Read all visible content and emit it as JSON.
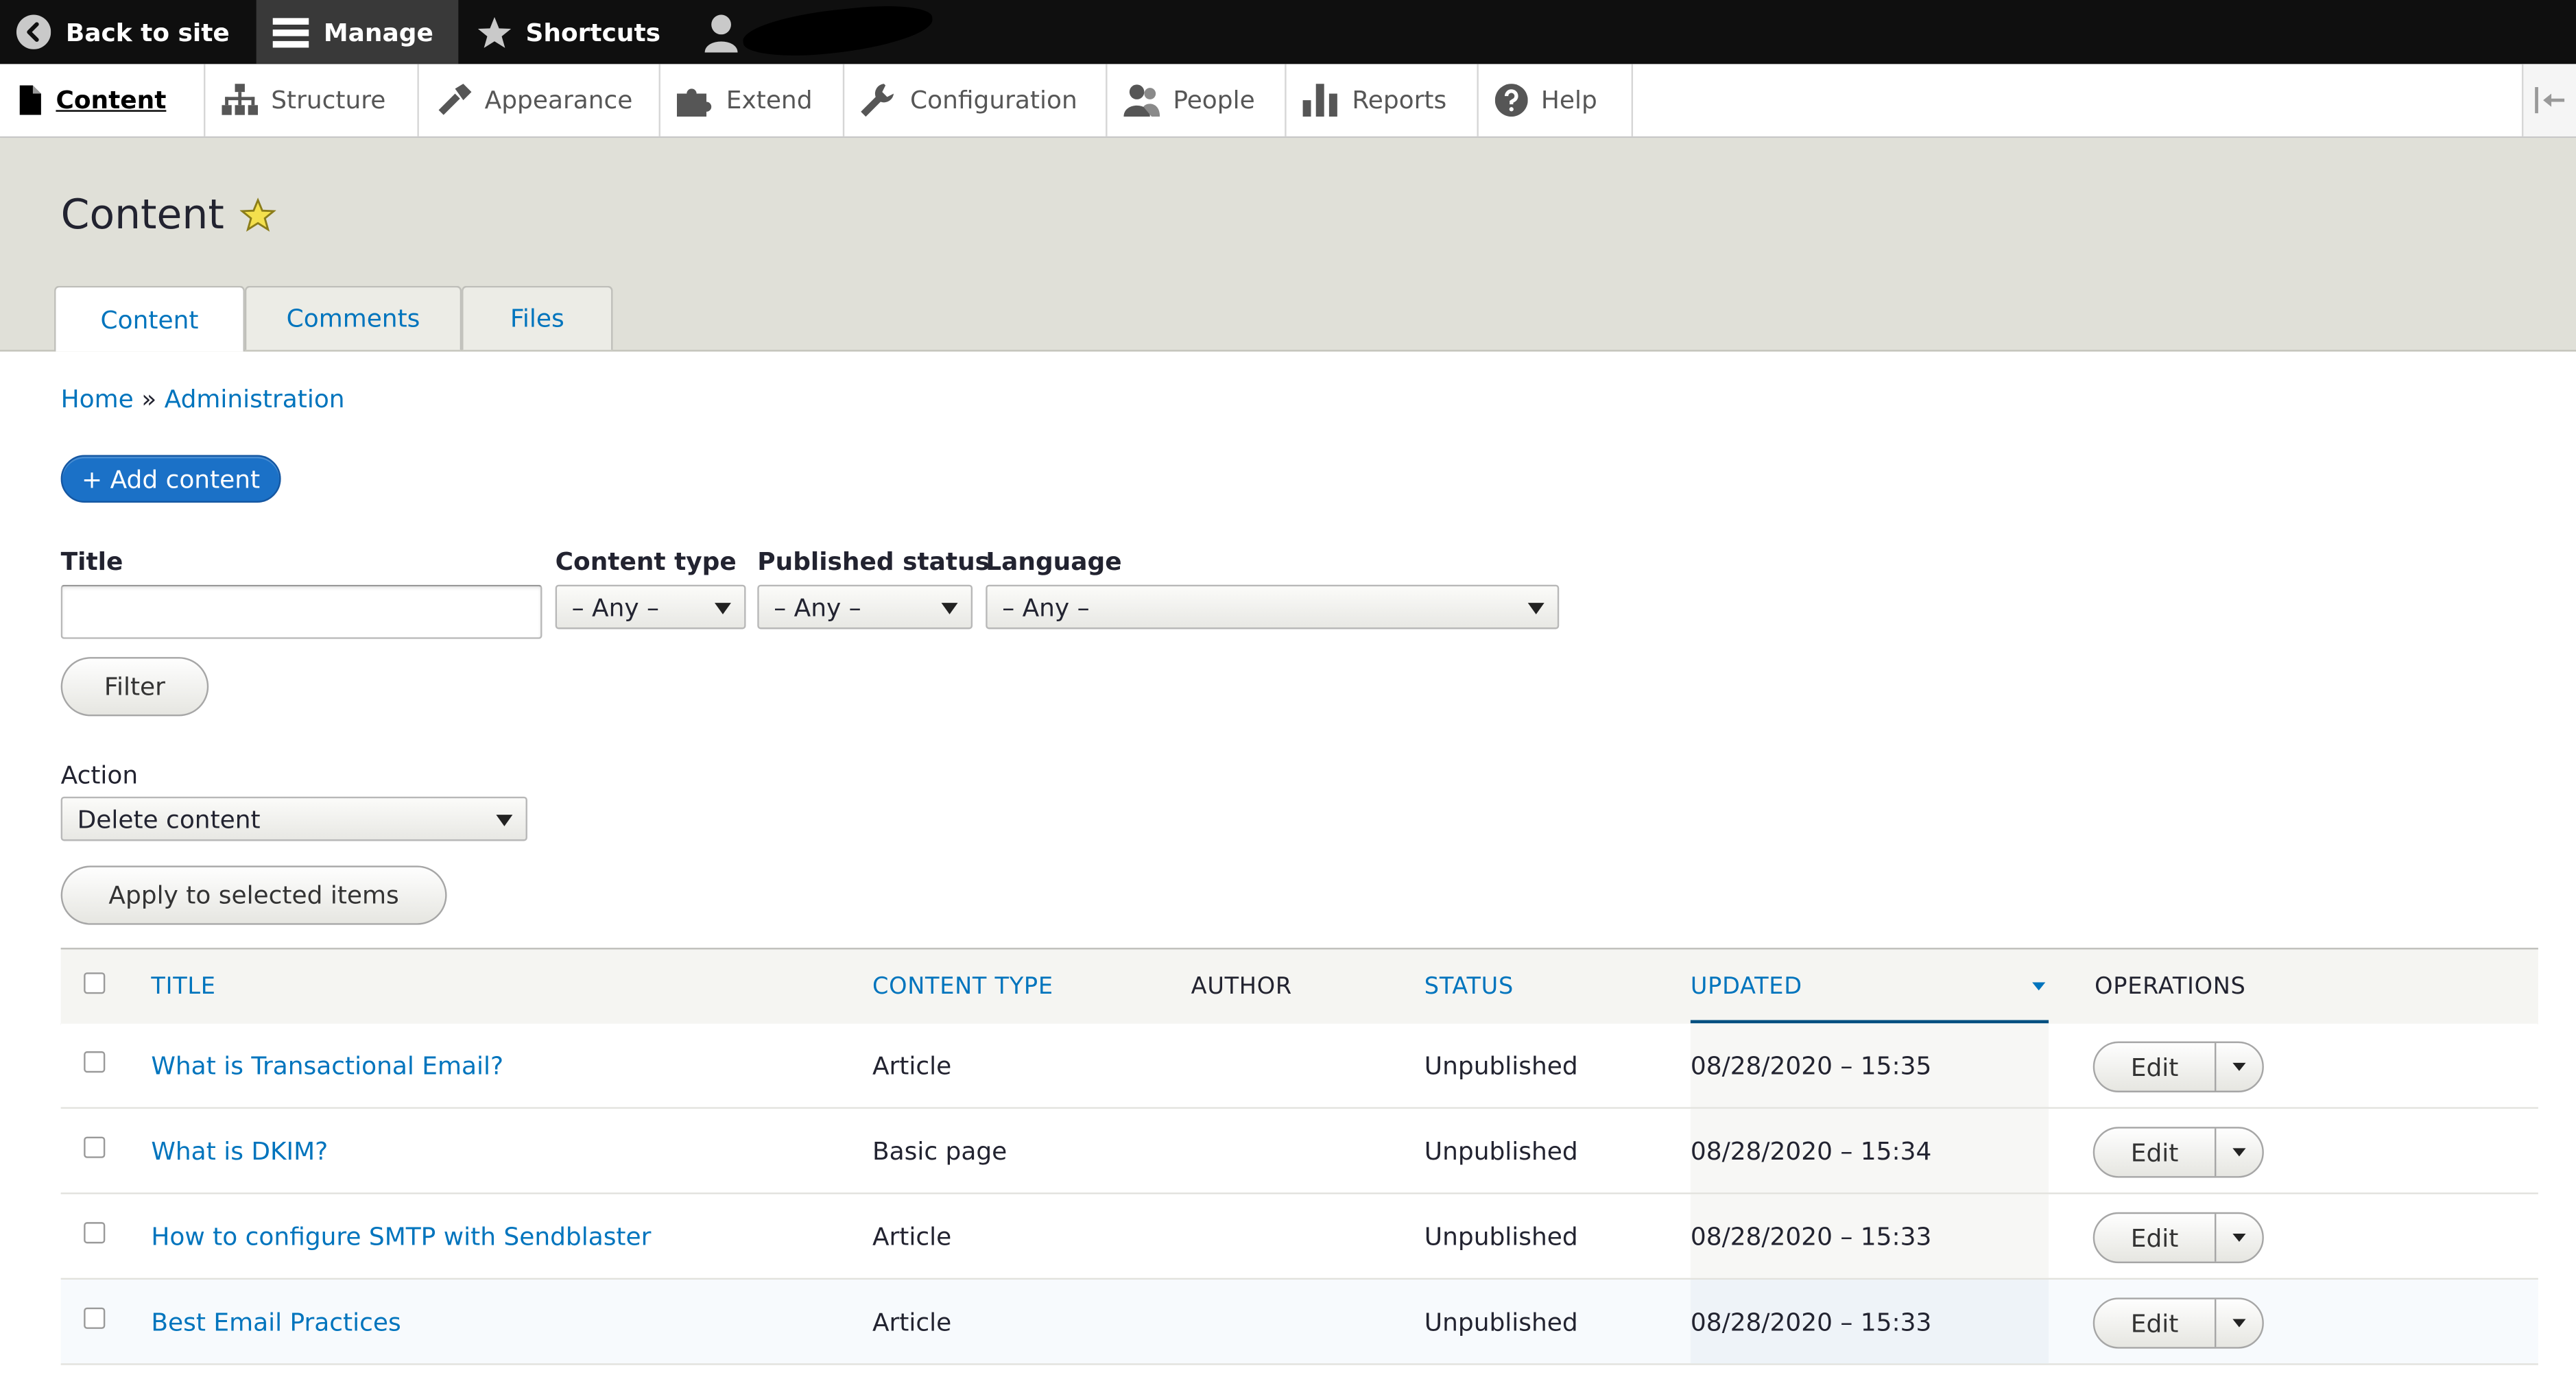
{
  "toolbar": {
    "back_label": "Back to site",
    "manage_label": "Manage",
    "shortcuts_label": "Shortcuts"
  },
  "tray": {
    "items": [
      {
        "label": "Content",
        "icon": "file-icon"
      },
      {
        "label": "Structure",
        "icon": "sitemap-icon"
      },
      {
        "label": "Appearance",
        "icon": "paintbrush-icon"
      },
      {
        "label": "Extend",
        "icon": "puzzle-icon"
      },
      {
        "label": "Configuration",
        "icon": "wrench-icon"
      },
      {
        "label": "People",
        "icon": "people-icon"
      },
      {
        "label": "Reports",
        "icon": "bar-chart-icon"
      },
      {
        "label": "Help",
        "icon": "help-icon"
      }
    ]
  },
  "header": {
    "title": "Content",
    "tabs": [
      "Content",
      "Comments",
      "Files"
    ]
  },
  "breadcrumb": {
    "home": "Home",
    "separator": "»",
    "admin": "Administration"
  },
  "add_content_label": "+ Add content",
  "filters": {
    "title_label": "Title",
    "title_value": "",
    "content_type_label": "Content type",
    "content_type_value": "– Any –",
    "published_status_label": "Published status",
    "published_status_value": "– Any –",
    "language_label": "Language",
    "language_value": "– Any –",
    "filter_button": "Filter"
  },
  "bulk": {
    "action_label": "Action",
    "action_value": "Delete content",
    "apply_button": "Apply to selected items"
  },
  "table": {
    "headers": {
      "title": "TITLE",
      "content_type": "CONTENT TYPE",
      "author": "AUTHOR",
      "status": "STATUS",
      "updated": "UPDATED",
      "operations": "OPERATIONS"
    },
    "edit_label": "Edit",
    "rows": [
      {
        "title": "What is Transactional Email?",
        "type": "Article",
        "author": "",
        "status": "Unpublished",
        "updated": "08/28/2020 – 15:35"
      },
      {
        "title": "What is DKIM?",
        "type": "Basic page",
        "author": "",
        "status": "Unpublished",
        "updated": "08/28/2020 – 15:34"
      },
      {
        "title": "How to configure SMTP with Sendblaster",
        "type": "Article",
        "author": "",
        "status": "Unpublished",
        "updated": "08/28/2020 – 15:33"
      },
      {
        "title": "Best Email Practices",
        "type": "Article",
        "author": "",
        "status": "Unpublished",
        "updated": "08/28/2020 – 15:33"
      }
    ]
  },
  "colors": {
    "link": "#0074bd",
    "primary_button": "#1b71c7",
    "toolbar_bg": "#0f0f0f",
    "header_bg": "#e0e0d8"
  }
}
